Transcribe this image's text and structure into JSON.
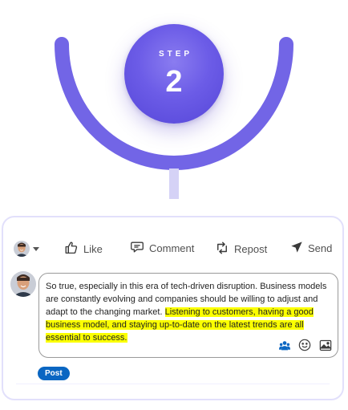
{
  "step": {
    "label": "STEP",
    "number": "2"
  },
  "colors": {
    "accent": "#6c5ce7",
    "arc": "#7265e6",
    "connector": "#d5d2f6",
    "card_border": "#e2e0fb",
    "highlight": "#fbff00",
    "post_button": "#0a66c2"
  },
  "actions": {
    "like": "Like",
    "comment": "Comment",
    "repost": "Repost",
    "send": "Send"
  },
  "comment": {
    "text_plain": "So true, especially in this era of tech-driven disruption. Business models are constantly evolving and companies should be willing to adjust and adapt to the changing market. ",
    "text_highlighted": "Listening to customers, having a good business model, and staying up-to-date on the latest trends are all essential to success."
  },
  "icons": {
    "avatar_switch": "profile-avatar",
    "like": "thumbs-up-icon",
    "comment": "speech-bubble-icon",
    "repost": "repost-arrows-icon",
    "send": "paper-plane-icon",
    "mention": "people-icon",
    "emoji": "smiley-icon",
    "image": "image-icon"
  },
  "post_button": {
    "label": "Post"
  }
}
